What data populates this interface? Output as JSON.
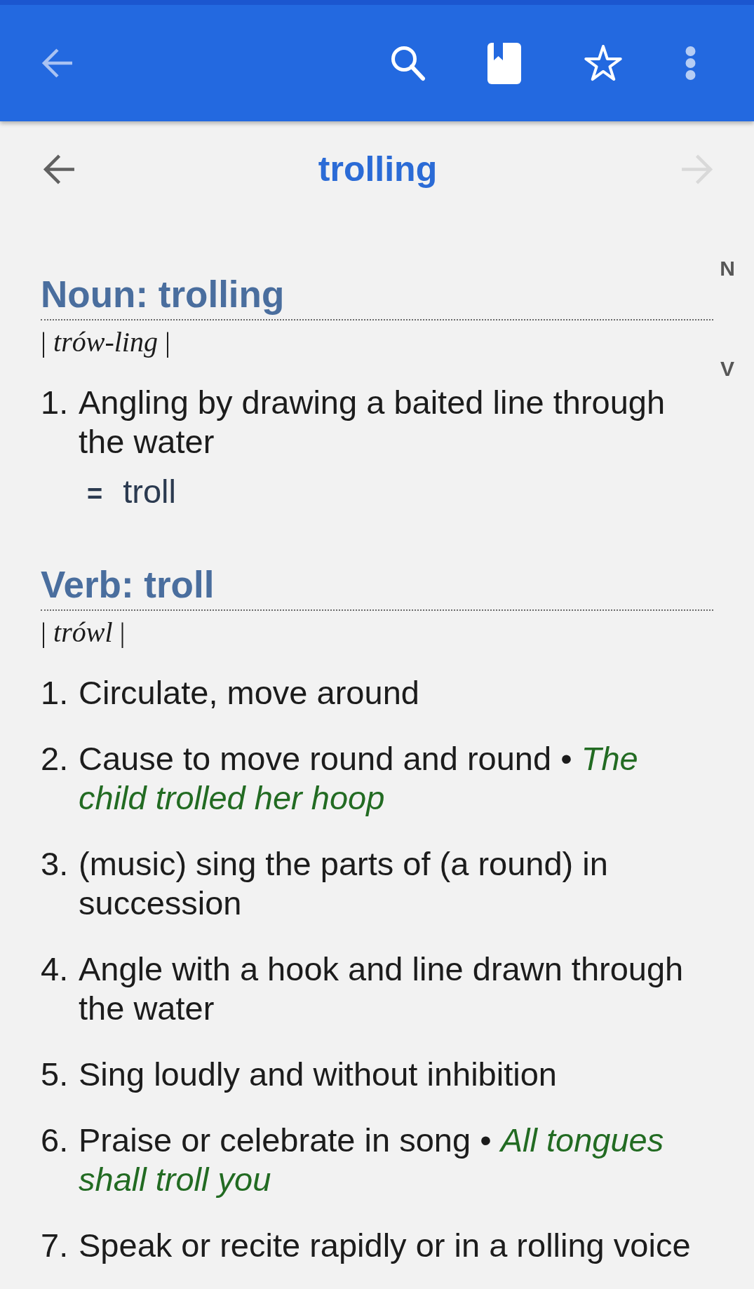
{
  "toolbar": {
    "starred": false
  },
  "header": {
    "word": "trolling",
    "back": {
      "disabled": false
    },
    "forward": {
      "disabled": true
    }
  },
  "index": [
    "N",
    "V"
  ],
  "entries": [
    {
      "heading": "Noun: trolling",
      "pronunciation": "| *trów-ling* |",
      "senses": [
        {
          "number": "1.",
          "text": "Angling by drawing a baited line through the water",
          "synonym": {
            "sign": "=",
            "word": "troll"
          }
        }
      ]
    },
    {
      "heading": "Verb: troll",
      "pronunciation": "| *trówl* |",
      "senses": [
        {
          "number": "1.",
          "text": "Circulate, move around"
        },
        {
          "number": "2.",
          "text": "Cause to move round and round • *The child trolled her hoop*"
        },
        {
          "number": "3.",
          "text": "(music) sing the parts of (a round) in succession"
        },
        {
          "number": "4.",
          "text": "Angle with a hook and line drawn through the water"
        },
        {
          "number": "5.",
          "text": "Sing loudly and without inhibition"
        },
        {
          "number": "6.",
          "text": "Praise or celebrate in song • *All tongues shall troll you*"
        },
        {
          "number": "7.",
          "text": "Speak or recite rapidly or in a rolling voice"
        }
      ]
    }
  ]
}
